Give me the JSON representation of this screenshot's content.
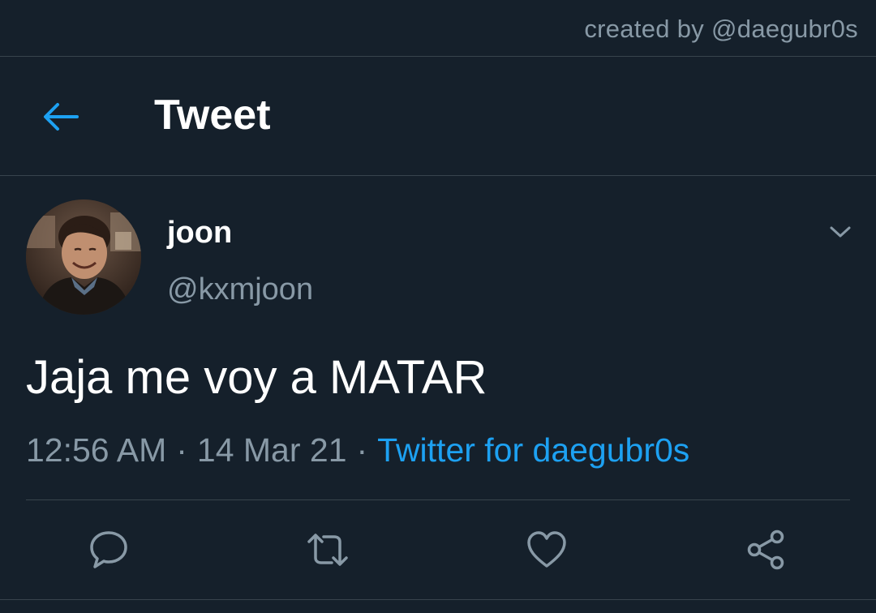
{
  "watermark": "created by @daegubr0s",
  "header": {
    "title": "Tweet",
    "back_icon": "arrow-left-icon"
  },
  "tweet": {
    "display_name": "joon",
    "handle": "@kxmjoon",
    "text": "Jaja me voy a MATAR",
    "time": "12:56 AM",
    "date": "14 Mar 21",
    "separator": "·",
    "source": "Twitter for daegubr0s"
  },
  "actions": [
    "reply-icon",
    "retweet-icon",
    "like-icon",
    "share-icon"
  ],
  "colors": {
    "background": "#15202b",
    "accent": "#1da1f2",
    "secondary_text": "#8899a6",
    "divider": "#38444d"
  }
}
